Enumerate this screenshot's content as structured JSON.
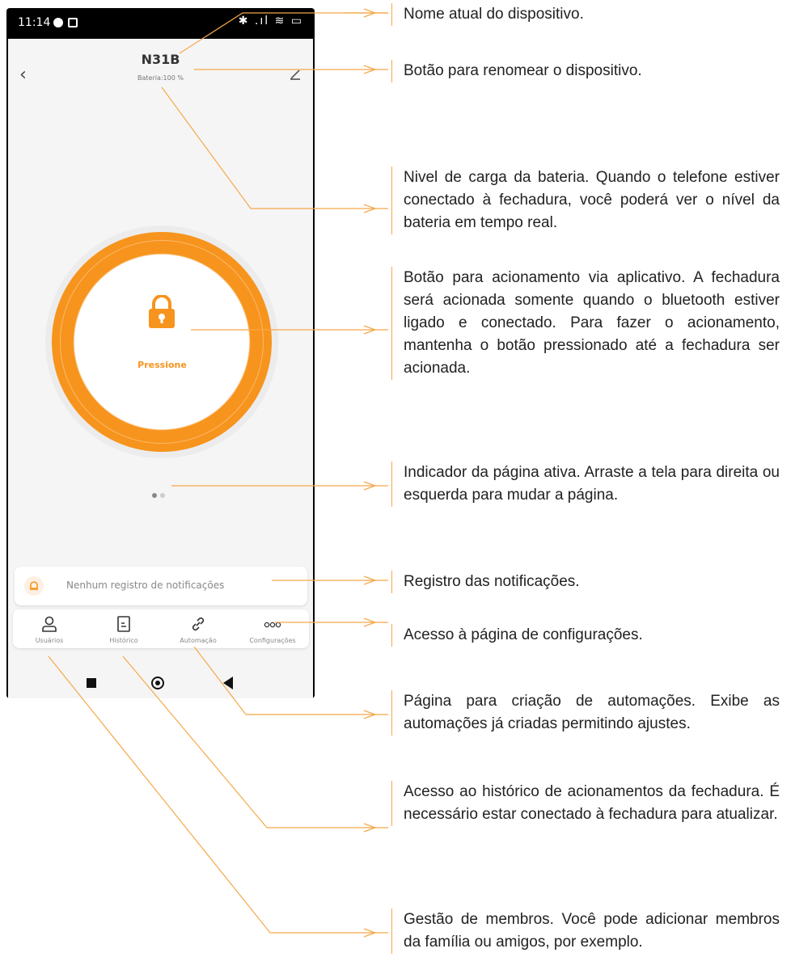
{
  "phone": {
    "status_time": "11:14",
    "status_right": "✱ .ıl ≋ ▭",
    "title": "N31B",
    "battery": "Bateria:100 %",
    "press_label": "Pressione",
    "notification_text": "Nenhum registro de notificações",
    "tabs": [
      {
        "label": "Usuários",
        "icon": "user-icon"
      },
      {
        "label": "Histórico",
        "icon": "document-icon"
      },
      {
        "label": "Automação",
        "icon": "link-icon"
      },
      {
        "label": "Configurações",
        "icon": "more-icon"
      }
    ]
  },
  "accent_color": "#f7941d",
  "callouts": [
    "Nome atual do dispositivo.",
    "Botão para renomear o dispositivo.",
    "Nivel de carga da bateria. Quando o telefone estiver conectado à fechadura, você poderá ver o nível da bateria em tempo real.",
    "Botão para acionamento via aplicativo. A fechadura será acionada somente quando o bluetooth estiver ligado e conectado. Para fazer o acionamento, mantenha o botão pressionado até a fechadura ser acionada.",
    "Indicador da página ativa. Arraste a tela para direita ou esquerda para mudar a página.",
    "Registro das notificações.",
    "Acesso à página de configurações.",
    "Página para criação de automações. Exibe as automações já criadas permitindo ajustes.",
    "Acesso ao histórico de acionamentos da fechadura. É necessário estar conectado à fechadura para atualizar.",
    "Gestão de membros. Você pode adicionar membros da família ou amigos, por exemplo."
  ]
}
